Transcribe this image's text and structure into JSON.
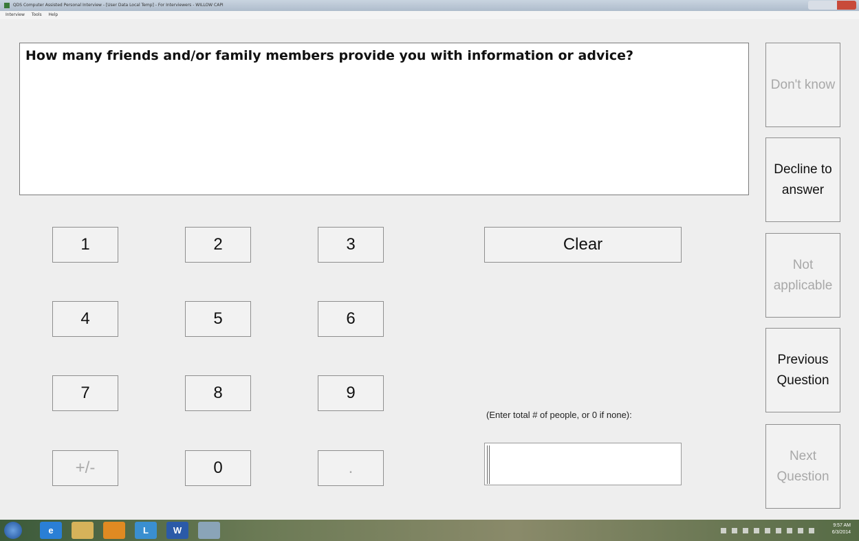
{
  "window": {
    "title": "QDS Computer Assisted Personal Interview - [User Data Local Temp] - For Interviewers - WILLOW CAPI",
    "menu": [
      "Interview",
      "Tools",
      "Help"
    ]
  },
  "question": {
    "text": "How many friends and/or family members provide you with information or advice?"
  },
  "keypad": {
    "keys": [
      "1",
      "2",
      "3",
      "4",
      "5",
      "6",
      "7",
      "8",
      "9",
      "+/-",
      "0",
      "."
    ],
    "clear_label": "Clear"
  },
  "side_buttons": {
    "dont_know": "Don't know",
    "decline": "Decline to answer",
    "not_applicable": "Not applicable",
    "previous": "Previous Question",
    "next": "Next Question"
  },
  "answer": {
    "hint": "(Enter total # of people, or 0 if none):",
    "value": ""
  },
  "taskbar": {
    "word_label": "W",
    "l_label": "L",
    "time": "9:57 AM",
    "date": "6/3/2014"
  }
}
